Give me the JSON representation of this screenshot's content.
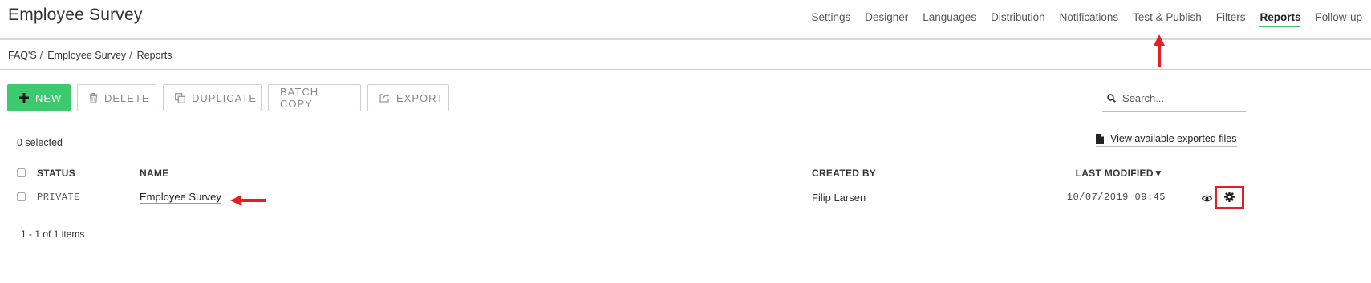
{
  "app": {
    "title": "Employee Survey"
  },
  "topnav": [
    "Settings",
    "Designer",
    "Languages",
    "Distribution",
    "Notifications",
    "Test & Publish",
    "Filters",
    "Reports",
    "Follow-up"
  ],
  "breadcrumb": {
    "items": [
      "FAQ'S",
      "Employee Survey",
      "Reports"
    ],
    "separator": "/"
  },
  "toolbar": {
    "new": "NEW",
    "delete": "DELETE",
    "duplicate": "DUPLICATE",
    "batch_copy": "BATCH COPY",
    "export": "EXPORT"
  },
  "search": {
    "placeholder": "Search..."
  },
  "selection": {
    "count_text": "0 selected"
  },
  "exports": {
    "link_text": "View available exported files"
  },
  "table": {
    "headers": {
      "status": "STATUS",
      "name": "NAME",
      "created_by": "CREATED BY",
      "last_modified": "LAST MODIFIED"
    },
    "sort_indicator": "▼",
    "rows": [
      {
        "status": "PRIVATE",
        "name": "Employee Survey",
        "created_by": "Filip Larsen",
        "last_modified": "10/07/2019 09:45"
      }
    ]
  },
  "pagination": {
    "summary": "1 - 1 of 1 items"
  },
  "colors": {
    "accent": "#3dc96d",
    "annotation_red": "#e41e26",
    "tab_underline": "#3cc46b"
  },
  "icons": [
    "plus-icon",
    "trash-icon",
    "duplicate-icon",
    "export-icon",
    "search-icon",
    "file-icon",
    "eye-icon",
    "gear-icon"
  ]
}
